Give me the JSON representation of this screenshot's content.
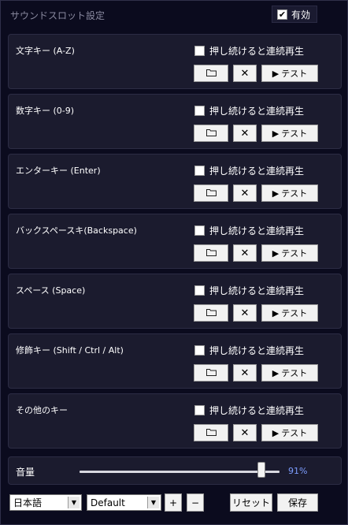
{
  "header": {
    "title": "サウンドスロット設定",
    "enabled_label": "有効",
    "enabled_checked": true
  },
  "common": {
    "repeat_label": "押し続けると連続再生",
    "folder_icon": "folder-icon",
    "clear_label": "✕",
    "test_label": "テスト",
    "test_icon": "play-icon"
  },
  "slots": [
    {
      "label": "文字キー (A-Z)",
      "repeat_checked": false
    },
    {
      "label": "数字キー (0-9)",
      "repeat_checked": false
    },
    {
      "label": "エンターキー (Enter)",
      "repeat_checked": false
    },
    {
      "label": "バックスペースキ(Backspace)",
      "repeat_checked": false
    },
    {
      "label": "スペース (Space)",
      "repeat_checked": false
    },
    {
      "label": "修飾キー (Shift / Ctrl / Alt)",
      "repeat_checked": false
    },
    {
      "label": "その他のキー",
      "repeat_checked": false
    }
  ],
  "volume": {
    "label": "音量",
    "value_text": "91%",
    "level": 0.91
  },
  "footer": {
    "language": "日本語",
    "preset": "Default",
    "add_label": "+",
    "remove_label": "−",
    "reset_label": "リセット",
    "save_label": "保存"
  },
  "colors": {
    "background": "#0b0b1e",
    "panel": "#1b1b2e",
    "accent": "#7d9dff"
  }
}
